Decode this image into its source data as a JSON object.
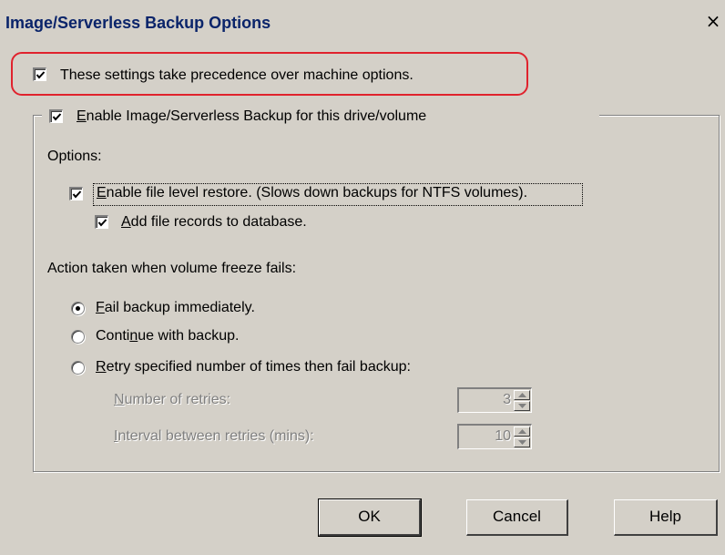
{
  "window": {
    "title": "Image/Serverless Backup Options",
    "close_glyph": "×"
  },
  "precedence": {
    "label": "These settings take precedence over machine options.",
    "checked": true
  },
  "enable_backup": {
    "label_ul": "E",
    "label_rest": "nable Image/Serverless Backup for this drive/volume",
    "checked": true
  },
  "options": {
    "heading": "Options:",
    "file_level_restore": {
      "label_ul": "E",
      "label_rest": "nable file level restore. (Slows down backups for NTFS volumes).",
      "checked": true
    },
    "add_file_records": {
      "label_ul": "A",
      "label_rest": "dd file records to database.",
      "checked": true
    }
  },
  "freeze_action": {
    "heading": "Action taken when volume freeze fails:",
    "choices": [
      {
        "ul": "F",
        "rest": "ail backup immediately.",
        "selected": true
      },
      {
        "pre": "Conti",
        "ul": "n",
        "rest": "ue with backup.",
        "selected": false
      },
      {
        "ul": "R",
        "rest": "etry specified number of times then fail backup:",
        "selected": false
      }
    ],
    "retries": {
      "label_ul": "N",
      "label_rest": "umber of retries:",
      "value": "3"
    },
    "interval": {
      "label_ul": "I",
      "label_rest": "nterval between retries (mins):",
      "value": "10"
    }
  },
  "buttons": {
    "ok": "OK",
    "cancel": "Cancel",
    "help": "Help"
  },
  "colors": {
    "title_text": "#0a246a",
    "highlight_border": "#e0222d",
    "dialog_bg": "#d4d0c8"
  }
}
